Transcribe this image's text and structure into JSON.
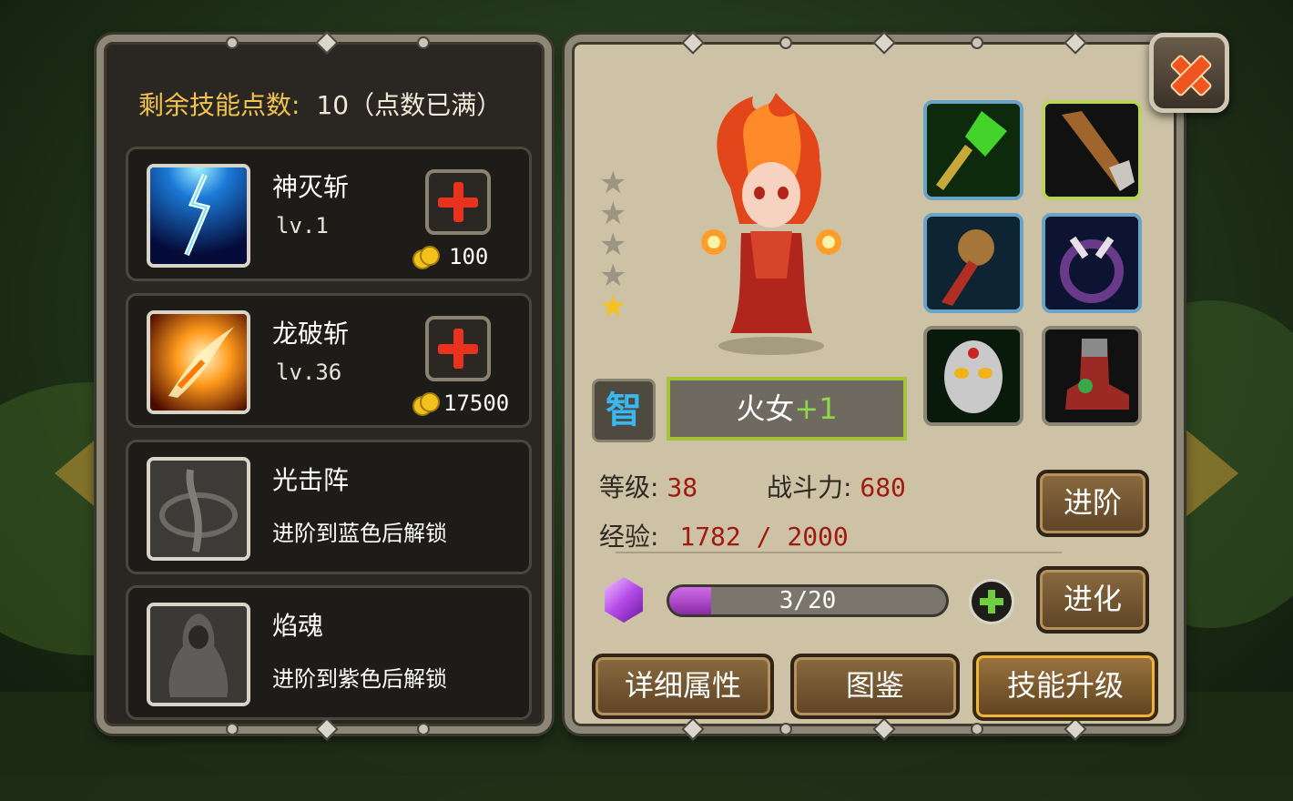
{
  "skill_panel": {
    "points_label": "剩余技能点数:",
    "points_value": "10（点数已满）",
    "skills": [
      {
        "name": "神灭斩",
        "level": "lv.1",
        "cost": "100",
        "icon": "lightning-skill-icon"
      },
      {
        "name": "龙破斩",
        "level": "lv.36",
        "cost": "17500",
        "icon": "fire-slash-skill-icon"
      },
      {
        "name": "光击阵",
        "lock_text": "进阶到蓝色后解锁",
        "icon": "light-strike-skill-icon"
      },
      {
        "name": "焰魂",
        "lock_text": "进阶到紫色后解锁",
        "icon": "flame-soul-skill-icon"
      }
    ]
  },
  "hero": {
    "name": "火女",
    "plus": "+1",
    "attribute_badge": "智",
    "stars_total": 5,
    "stars_lit": 1,
    "level_label": "等级:",
    "level_value": "38",
    "power_label": "战斗力:",
    "power_value": "680",
    "exp_label": "经验:",
    "exp_value": "1782 / 2000",
    "soulstone_progress_text": "3/20",
    "soulstone_progress_fraction": 0.15
  },
  "equipment": [
    {
      "icon": "green-crystal-staff-icon",
      "frame": "blue"
    },
    {
      "icon": "wooden-cudgel-icon",
      "frame": "green"
    },
    {
      "icon": "bird-scepter-icon",
      "frame": "blue"
    },
    {
      "icon": "claw-ring-icon",
      "frame": "blue"
    },
    {
      "icon": "mask-icon",
      "frame": "plain"
    },
    {
      "icon": "armored-boot-icon",
      "frame": "plain"
    }
  ],
  "buttons": {
    "advance": "进阶",
    "evolve": "进化",
    "details": "详细属性",
    "codex": "图鉴",
    "skill_upgrade": "技能升级"
  },
  "colors": {
    "accent_gold": "#f3c44b",
    "value_red": "#a11a12",
    "plus_red": "#e8321e",
    "name_frame_green": "#a3c43a"
  }
}
